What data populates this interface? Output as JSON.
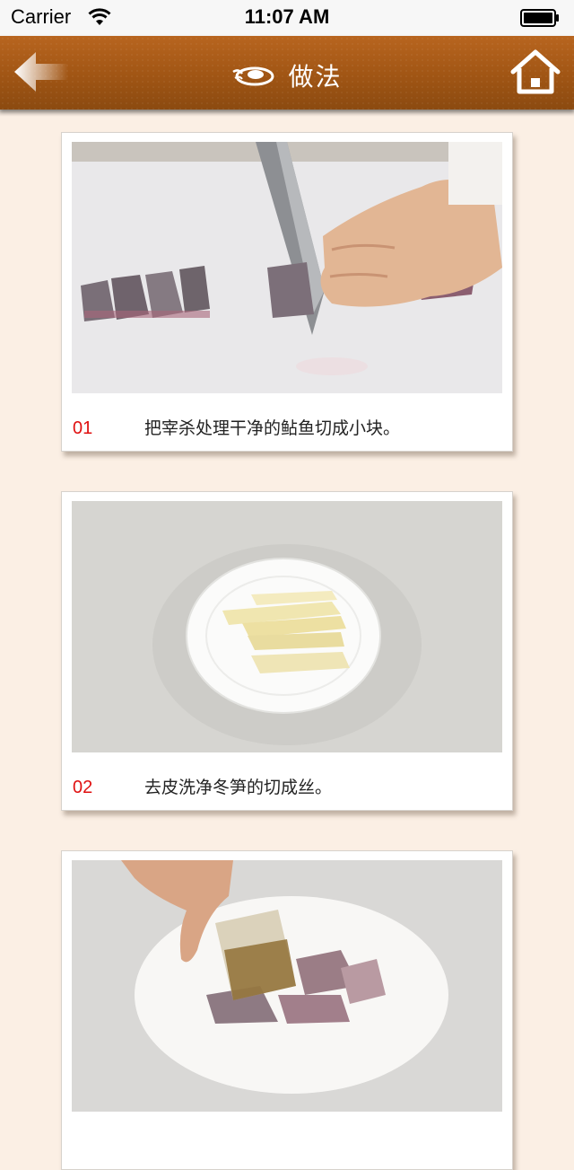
{
  "status_bar": {
    "carrier": "Carrier",
    "time": "11:07 AM"
  },
  "nav": {
    "title": "做法",
    "back_icon": "back-arrow-icon",
    "home_icon": "home-icon",
    "title_icon": "plate-icon",
    "colors": {
      "bar": "#a05514",
      "accent": "#ffffff"
    }
  },
  "steps": [
    {
      "number": "01",
      "text": "把宰杀处理干净的鲇鱼切成小块。"
    },
    {
      "number": "02",
      "text": "去皮洗净冬笋的切成丝。"
    },
    {
      "number": "",
      "text": ""
    }
  ],
  "colors": {
    "background": "#fbefe4",
    "step_number": "#e01010"
  }
}
